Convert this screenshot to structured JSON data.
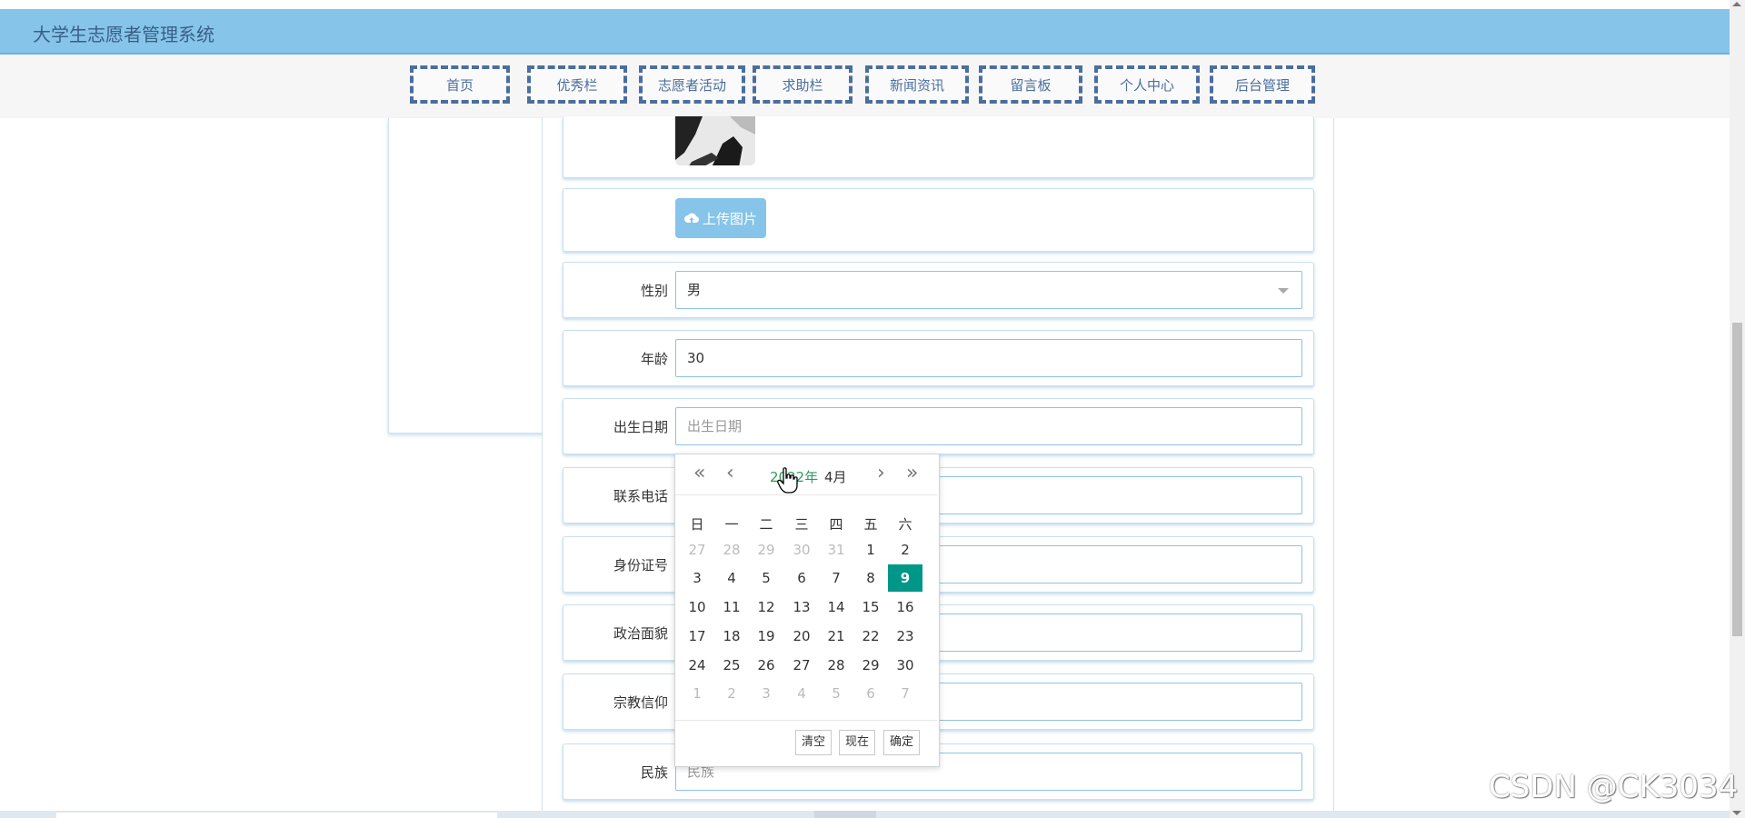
{
  "app": {
    "title": "大学生志愿者管理系统"
  },
  "nav": [
    {
      "label": "首页"
    },
    {
      "label": "优秀栏"
    },
    {
      "label": "志愿者活动"
    },
    {
      "label": "求助栏"
    },
    {
      "label": "新闻资讯"
    },
    {
      "label": "留言板"
    },
    {
      "label": "个人中心"
    },
    {
      "label": "后台管理"
    }
  ],
  "form": {
    "upload_label": "上传图片",
    "fields": {
      "gender": {
        "label": "性别",
        "value": "男"
      },
      "age": {
        "label": "年龄",
        "value": "30"
      },
      "birthdate": {
        "label": "出生日期",
        "placeholder": "出生日期"
      },
      "phone": {
        "label": "联系电话"
      },
      "idcard": {
        "label": "身份证号"
      },
      "political": {
        "label": "政治面貌"
      },
      "religion": {
        "label": "宗教信仰"
      },
      "ethnicity": {
        "label": "民族",
        "placeholder": "民族"
      }
    }
  },
  "datepicker": {
    "year_label": "2022年",
    "month_label": "4月",
    "weekdays": [
      "日",
      "一",
      "二",
      "三",
      "四",
      "五",
      "六"
    ],
    "selected_day": "9",
    "weeks": [
      [
        "27",
        "28",
        "29",
        "30",
        "31",
        "1",
        "2"
      ],
      [
        "3",
        "4",
        "5",
        "6",
        "7",
        "8",
        "9"
      ],
      [
        "10",
        "11",
        "12",
        "13",
        "14",
        "15",
        "16"
      ],
      [
        "17",
        "18",
        "19",
        "20",
        "21",
        "22",
        "23"
      ],
      [
        "24",
        "25",
        "26",
        "27",
        "28",
        "29",
        "30"
      ],
      [
        "1",
        "2",
        "3",
        "4",
        "5",
        "6",
        "7"
      ]
    ],
    "buttons": {
      "clear": "清空",
      "now": "现在",
      "confirm": "确定"
    }
  },
  "watermark": "CSDN @CK3034",
  "colors": {
    "header": "#86c4ea",
    "nav_border": "#4a6e9e",
    "selected_day": "#009688",
    "year_text": "#2f9a5e"
  }
}
